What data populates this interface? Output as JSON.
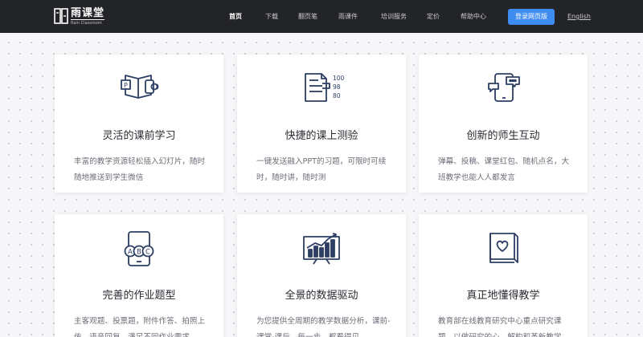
{
  "header": {
    "logo_cn": "雨课堂",
    "logo_en": "Rain Classroom",
    "nav": [
      {
        "label": "首页",
        "active": true
      },
      {
        "label": "下载",
        "active": false
      },
      {
        "label": "翻页笔",
        "active": false
      },
      {
        "label": "雨课件",
        "active": false
      },
      {
        "label": "培训服务",
        "active": false
      },
      {
        "label": "定价",
        "active": false
      },
      {
        "label": "帮助中心",
        "active": false
      }
    ],
    "login_label": "登录网页版",
    "lang_label": "English"
  },
  "features": [
    {
      "icon": "book-slides-icon",
      "title": "灵活的课前学习",
      "desc": "丰富的教学资源轻松插入幻灯片，随时随地推送到学生微信"
    },
    {
      "icon": "quiz-document-icon",
      "title": "快捷的课上测验",
      "desc": "一键发送融入PPT的习题，可限时可续时，随时讲，随时测"
    },
    {
      "icon": "phone-chat-icon",
      "title": "创新的师生互动",
      "desc": "弹幕、投稿、课堂红包、随机点名，大班教学也能人人都发言"
    },
    {
      "icon": "abc-choice-icon",
      "title": "完善的作业题型",
      "desc": "主客观题、投票题，附件作答、拍照上传、语音回复，满足不同作业需求"
    },
    {
      "icon": "bar-chart-icon",
      "title": "全景的数据驱动",
      "desc": "为您提供全周期的教学数据分析，课前-课堂-课后，每一步，都看得见"
    },
    {
      "icon": "heart-book-icon",
      "title": "真正地懂得教学",
      "desc": "教育部在线教育研究中心重点研究课题，以做研究的心，解构和革新教学"
    }
  ],
  "colors": {
    "accent": "#3f8cf0",
    "header_bg": "#232427",
    "icon_stroke": "#2c3e63"
  }
}
